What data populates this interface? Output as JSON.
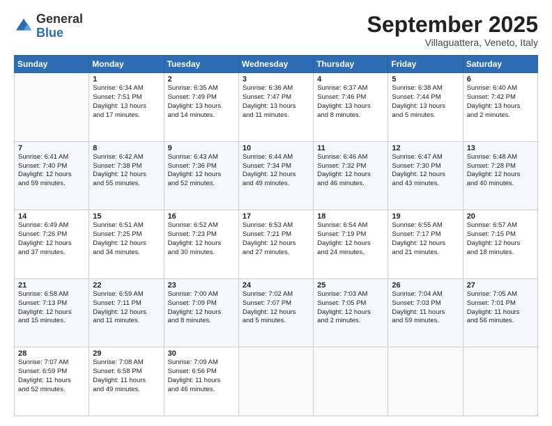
{
  "logo": {
    "general": "General",
    "blue": "Blue"
  },
  "header": {
    "month": "September 2025",
    "location": "Villaguattera, Veneto, Italy"
  },
  "weekdays": [
    "Sunday",
    "Monday",
    "Tuesday",
    "Wednesday",
    "Thursday",
    "Friday",
    "Saturday"
  ],
  "weeks": [
    [
      {
        "day": "",
        "lines": []
      },
      {
        "day": "1",
        "lines": [
          "Sunrise: 6:34 AM",
          "Sunset: 7:51 PM",
          "Daylight: 13 hours",
          "and 17 minutes."
        ]
      },
      {
        "day": "2",
        "lines": [
          "Sunrise: 6:35 AM",
          "Sunset: 7:49 PM",
          "Daylight: 13 hours",
          "and 14 minutes."
        ]
      },
      {
        "day": "3",
        "lines": [
          "Sunrise: 6:36 AM",
          "Sunset: 7:47 PM",
          "Daylight: 13 hours",
          "and 11 minutes."
        ]
      },
      {
        "day": "4",
        "lines": [
          "Sunrise: 6:37 AM",
          "Sunset: 7:46 PM",
          "Daylight: 13 hours",
          "and 8 minutes."
        ]
      },
      {
        "day": "5",
        "lines": [
          "Sunrise: 6:38 AM",
          "Sunset: 7:44 PM",
          "Daylight: 13 hours",
          "and 5 minutes."
        ]
      },
      {
        "day": "6",
        "lines": [
          "Sunrise: 6:40 AM",
          "Sunset: 7:42 PM",
          "Daylight: 13 hours",
          "and 2 minutes."
        ]
      }
    ],
    [
      {
        "day": "7",
        "lines": [
          "Sunrise: 6:41 AM",
          "Sunset: 7:40 PM",
          "Daylight: 12 hours",
          "and 59 minutes."
        ]
      },
      {
        "day": "8",
        "lines": [
          "Sunrise: 6:42 AM",
          "Sunset: 7:38 PM",
          "Daylight: 12 hours",
          "and 55 minutes."
        ]
      },
      {
        "day": "9",
        "lines": [
          "Sunrise: 6:43 AM",
          "Sunset: 7:36 PM",
          "Daylight: 12 hours",
          "and 52 minutes."
        ]
      },
      {
        "day": "10",
        "lines": [
          "Sunrise: 6:44 AM",
          "Sunset: 7:34 PM",
          "Daylight: 12 hours",
          "and 49 minutes."
        ]
      },
      {
        "day": "11",
        "lines": [
          "Sunrise: 6:46 AM",
          "Sunset: 7:32 PM",
          "Daylight: 12 hours",
          "and 46 minutes."
        ]
      },
      {
        "day": "12",
        "lines": [
          "Sunrise: 6:47 AM",
          "Sunset: 7:30 PM",
          "Daylight: 12 hours",
          "and 43 minutes."
        ]
      },
      {
        "day": "13",
        "lines": [
          "Sunrise: 6:48 AM",
          "Sunset: 7:28 PM",
          "Daylight: 12 hours",
          "and 40 minutes."
        ]
      }
    ],
    [
      {
        "day": "14",
        "lines": [
          "Sunrise: 6:49 AM",
          "Sunset: 7:26 PM",
          "Daylight: 12 hours",
          "and 37 minutes."
        ]
      },
      {
        "day": "15",
        "lines": [
          "Sunrise: 6:51 AM",
          "Sunset: 7:25 PM",
          "Daylight: 12 hours",
          "and 34 minutes."
        ]
      },
      {
        "day": "16",
        "lines": [
          "Sunrise: 6:52 AM",
          "Sunset: 7:23 PM",
          "Daylight: 12 hours",
          "and 30 minutes."
        ]
      },
      {
        "day": "17",
        "lines": [
          "Sunrise: 6:53 AM",
          "Sunset: 7:21 PM",
          "Daylight: 12 hours",
          "and 27 minutes."
        ]
      },
      {
        "day": "18",
        "lines": [
          "Sunrise: 6:54 AM",
          "Sunset: 7:19 PM",
          "Daylight: 12 hours",
          "and 24 minutes."
        ]
      },
      {
        "day": "19",
        "lines": [
          "Sunrise: 6:55 AM",
          "Sunset: 7:17 PM",
          "Daylight: 12 hours",
          "and 21 minutes."
        ]
      },
      {
        "day": "20",
        "lines": [
          "Sunrise: 6:57 AM",
          "Sunset: 7:15 PM",
          "Daylight: 12 hours",
          "and 18 minutes."
        ]
      }
    ],
    [
      {
        "day": "21",
        "lines": [
          "Sunrise: 6:58 AM",
          "Sunset: 7:13 PM",
          "Daylight: 12 hours",
          "and 15 minutes."
        ]
      },
      {
        "day": "22",
        "lines": [
          "Sunrise: 6:59 AM",
          "Sunset: 7:11 PM",
          "Daylight: 12 hours",
          "and 11 minutes."
        ]
      },
      {
        "day": "23",
        "lines": [
          "Sunrise: 7:00 AM",
          "Sunset: 7:09 PM",
          "Daylight: 12 hours",
          "and 8 minutes."
        ]
      },
      {
        "day": "24",
        "lines": [
          "Sunrise: 7:02 AM",
          "Sunset: 7:07 PM",
          "Daylight: 12 hours",
          "and 5 minutes."
        ]
      },
      {
        "day": "25",
        "lines": [
          "Sunrise: 7:03 AM",
          "Sunset: 7:05 PM",
          "Daylight: 12 hours",
          "and 2 minutes."
        ]
      },
      {
        "day": "26",
        "lines": [
          "Sunrise: 7:04 AM",
          "Sunset: 7:03 PM",
          "Daylight: 11 hours",
          "and 59 minutes."
        ]
      },
      {
        "day": "27",
        "lines": [
          "Sunrise: 7:05 AM",
          "Sunset: 7:01 PM",
          "Daylight: 11 hours",
          "and 56 minutes."
        ]
      }
    ],
    [
      {
        "day": "28",
        "lines": [
          "Sunrise: 7:07 AM",
          "Sunset: 6:59 PM",
          "Daylight: 11 hours",
          "and 52 minutes."
        ]
      },
      {
        "day": "29",
        "lines": [
          "Sunrise: 7:08 AM",
          "Sunset: 6:58 PM",
          "Daylight: 11 hours",
          "and 49 minutes."
        ]
      },
      {
        "day": "30",
        "lines": [
          "Sunrise: 7:09 AM",
          "Sunset: 6:56 PM",
          "Daylight: 11 hours",
          "and 46 minutes."
        ]
      },
      {
        "day": "",
        "lines": []
      },
      {
        "day": "",
        "lines": []
      },
      {
        "day": "",
        "lines": []
      },
      {
        "day": "",
        "lines": []
      }
    ]
  ]
}
